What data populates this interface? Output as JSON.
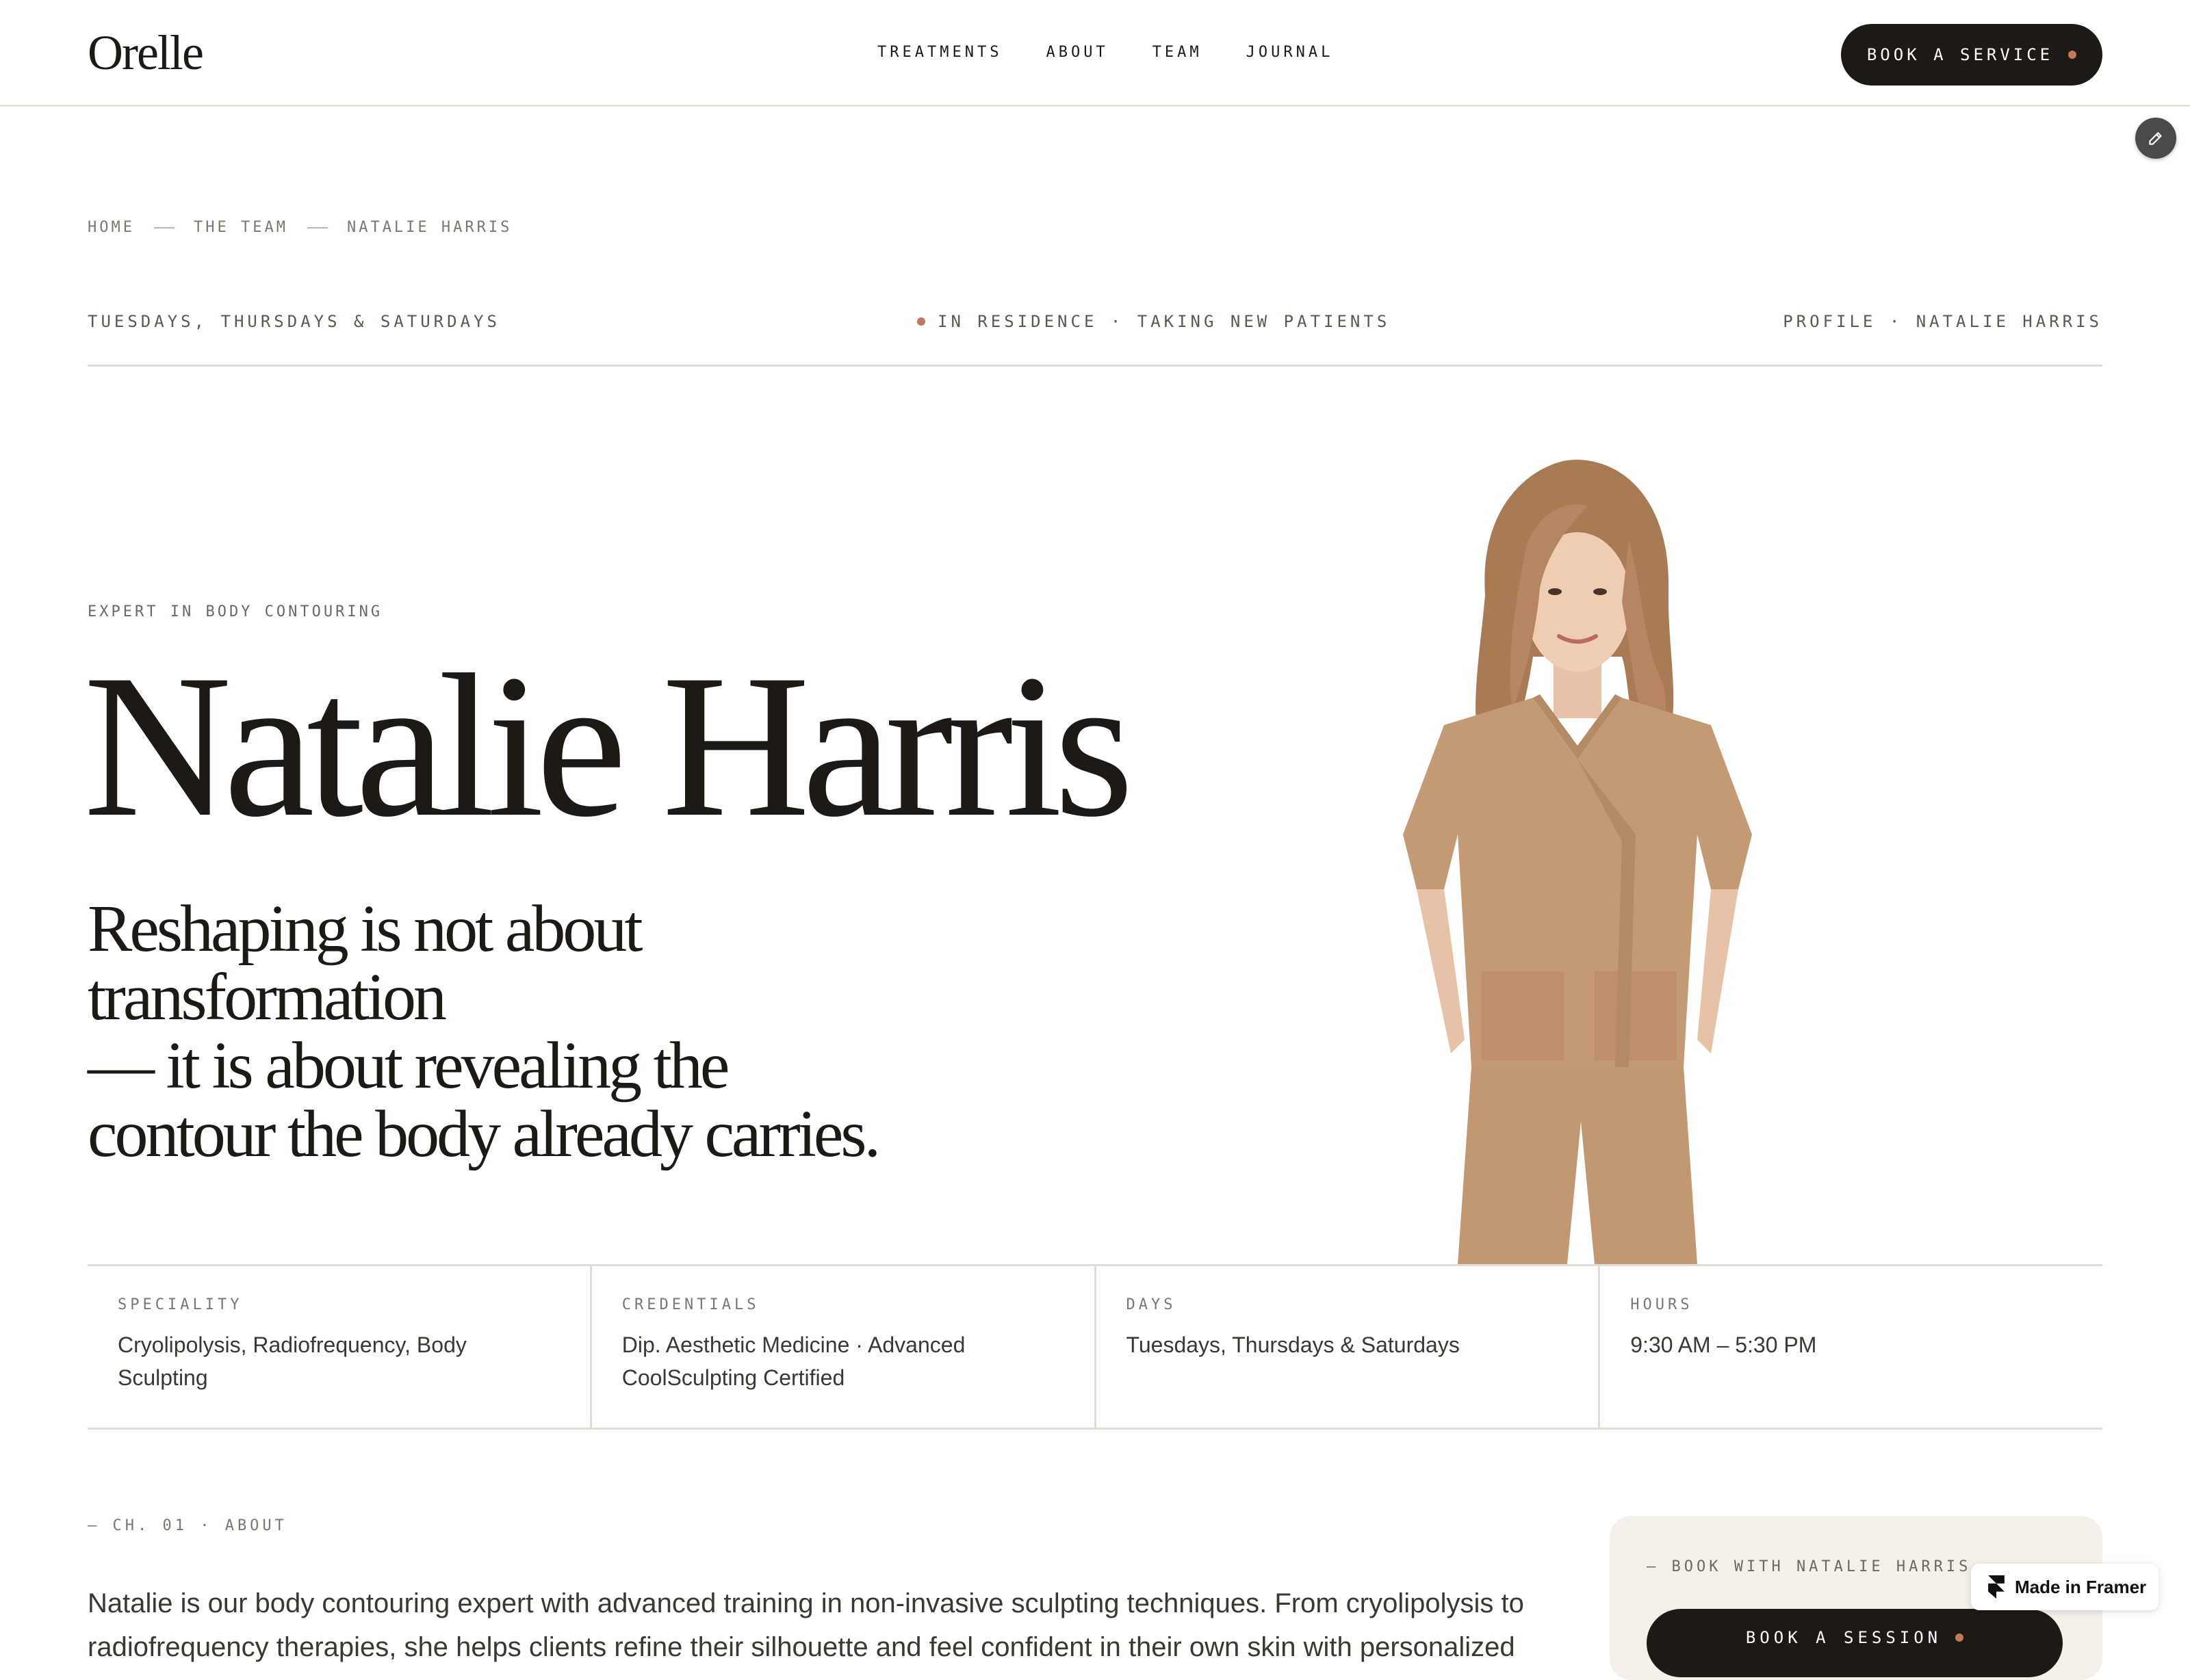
{
  "header": {
    "logo": "Orelle",
    "nav": [
      {
        "label": "TREATMENTS"
      },
      {
        "label": "ABOUT"
      },
      {
        "label": "TEAM"
      },
      {
        "label": "JOURNAL"
      }
    ],
    "cta_label": "BOOK A SERVICE",
    "accent_color": "#c0795a"
  },
  "edit_button": {
    "icon": "pencil-icon"
  },
  "breadcrumb": [
    "HOME",
    "THE TEAM",
    "NATALIE HARRIS"
  ],
  "status": {
    "schedule": "TUESDAYS, THURSDAYS & SATURDAYS",
    "availability": "IN RESIDENCE · TAKING NEW PATIENTS",
    "profile": "PROFILE · NATALIE HARRIS"
  },
  "hero": {
    "eyebrow": "EXPERT IN BODY CONTOURING",
    "name": "Natalie Harris",
    "quote_lines": [
      "Reshaping is not about transformation",
      "— it is about revealing the",
      "contour the body already carries."
    ]
  },
  "info": [
    {
      "label": "SPECIALITY",
      "value": "Cryolipolysis, Radiofrequency, Body Sculpting"
    },
    {
      "label": "CREDENTIALS",
      "value": "Dip. Aesthetic Medicine · Advanced CoolSculpting Certified"
    },
    {
      "label": "DAYS",
      "value": "Tuesdays, Thursdays & Saturdays"
    },
    {
      "label": "HOURS",
      "value": "9:30 AM – 5:30 PM"
    }
  ],
  "about": {
    "chapter": "— CH. 01 · ABOUT",
    "text": "Natalie is our body contouring expert with advanced training in non-invasive sculpting techniques. From cryolipolysis to radiofrequency therapies, she helps clients refine their silhouette and feel confident in their own skin with personalized"
  },
  "booking": {
    "label": "— BOOK WITH NATALIE HARRIS",
    "button_label": "BOOK A SESSION"
  },
  "framer_badge": {
    "label": "Made in Framer"
  }
}
